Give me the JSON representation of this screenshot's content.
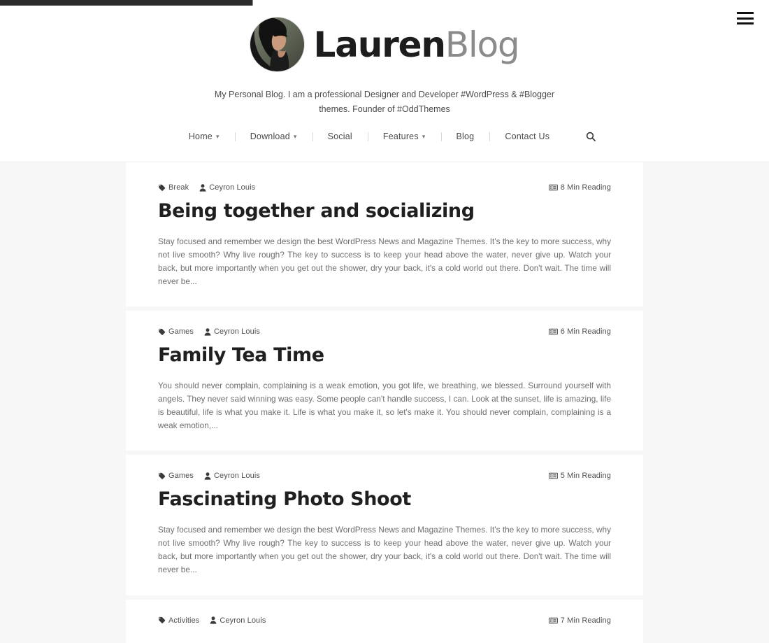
{
  "topbar": {
    "progress_percent": 33,
    "accent_color": "#2b2b2b"
  },
  "header": {
    "menu_icon": "hamburger-icon",
    "brand": {
      "name_bold": "Lauren",
      "name_light": "Blog",
      "avatar_alt": "avatar"
    },
    "tagline": "My Personal Blog. I am a professional Designer and Developer #WordPress & #Blogger themes. Founder of #OddThemes",
    "nav": [
      {
        "label": "Home",
        "has_dropdown": true
      },
      {
        "label": "Download",
        "has_dropdown": true
      },
      {
        "label": "Social",
        "has_dropdown": false
      },
      {
        "label": "Features",
        "has_dropdown": true
      },
      {
        "label": "Blog",
        "has_dropdown": false
      },
      {
        "label": "Contact Us",
        "has_dropdown": false
      }
    ],
    "search_icon": "search-icon"
  },
  "posts": [
    {
      "category": "Break",
      "author": "Ceyron Louis",
      "reading_time": "8 Min Reading",
      "title": "Being together and socializing",
      "excerpt": "Stay focused and remember we design the best WordPress News and Magazine Themes. It's the key to more success, why not live smooth? Why live rough? The key to success is to keep your head above the water, never give up. Watch your back, but more importantly when you get out the shower, dry your back, it's a cold world out there. Don't wait. The time will never be..."
    },
    {
      "category": "Games",
      "author": "Ceyron Louis",
      "reading_time": "6 Min Reading",
      "title": "Family Tea Time",
      "excerpt": "You should never complain, complaining is a weak emotion, you got life, we breathing, we blessed. Surround yourself with angels. They never said winning was easy. Some people can't handle success, I can. Look at the sunset, life is amazing, life is beautiful, life is what you make it. Life is what you make it, so let's make it. You should never complain, complaining is a weak emotion,..."
    },
    {
      "category": "Games",
      "author": "Ceyron Louis",
      "reading_time": "5 Min Reading",
      "title": "Fascinating Photo Shoot",
      "excerpt": "Stay focused and remember we design the best WordPress News and Magazine Themes. It's the key to more success, why not live smooth? Why live rough? The key to success is to keep your head above the water, never give up. Watch your back, but more importantly when you get out the shower, dry your back, it's a cold world out there. Don't wait. The time will never be..."
    },
    {
      "category": "Activities",
      "author": "Ceyron Louis",
      "reading_time": "7 Min Reading",
      "title": "",
      "excerpt": ""
    }
  ],
  "icons": {
    "tag": "tag-icon",
    "user": "user-icon",
    "reading": "book-icon"
  }
}
